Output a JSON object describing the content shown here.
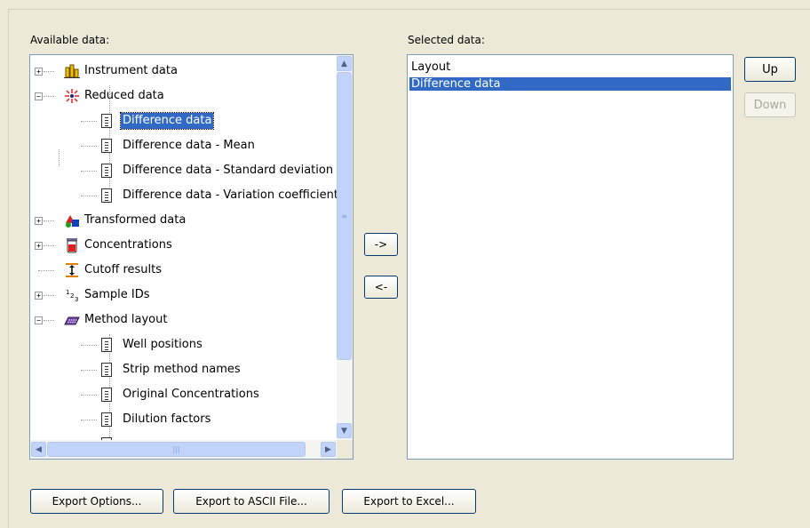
{
  "labels": {
    "available": "Available data:",
    "selected": "Selected data:"
  },
  "tree": [
    {
      "label": "Instrument data",
      "icon": "chart-icon",
      "expander": "plus"
    },
    {
      "label": "Reduced data",
      "icon": "scatter-icon",
      "expander": "minus"
    },
    {
      "label": "Difference data",
      "icon": "document-icon",
      "selected": true
    },
    {
      "label": "Difference data - Mean",
      "icon": "document-icon"
    },
    {
      "label": "Difference data - Standard deviation",
      "icon": "document-icon"
    },
    {
      "label": "Difference data - Variation coefficient",
      "icon": "document-icon"
    },
    {
      "label": "Transformed data",
      "icon": "shapes-icon",
      "expander": "plus"
    },
    {
      "label": "Concentrations",
      "icon": "beaker-icon",
      "expander": "plus"
    },
    {
      "label": "Cutoff results",
      "icon": "cutoff-icon"
    },
    {
      "label": "Sample IDs",
      "icon": "numbers-icon",
      "expander": "plus"
    },
    {
      "label": "Method layout",
      "icon": "plate-icon",
      "expander": "minus"
    },
    {
      "label": "Well positions",
      "icon": "document-icon"
    },
    {
      "label": "Strip method names",
      "icon": "document-icon"
    },
    {
      "label": "Original Concentrations",
      "icon": "document-icon"
    },
    {
      "label": "Dilution factors",
      "icon": "document-icon"
    }
  ],
  "selected_list": [
    {
      "label": "Layout"
    },
    {
      "label": "Difference data",
      "highlighted": true
    }
  ],
  "buttons": {
    "add": "->",
    "remove": "<-",
    "up": "Up",
    "down": "Down",
    "export_options": "Export Options...",
    "export_ascii": "Export to ASCII File...",
    "export_excel": "Export to Excel..."
  },
  "colors": {
    "selection": "#316ac5",
    "window_bg": "#ece9d8"
  }
}
